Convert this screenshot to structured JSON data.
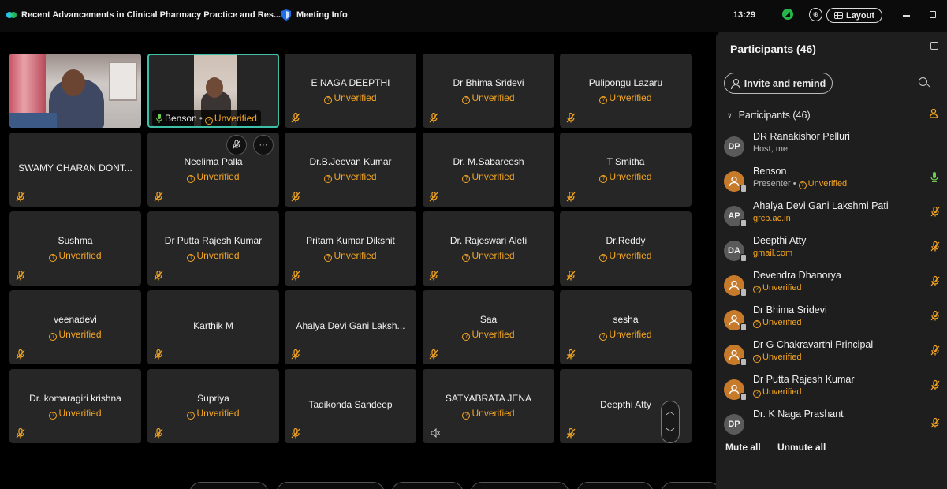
{
  "window": {
    "title": "Recent Advancements in Clinical Pharmacy Practice and Res...",
    "meeting_info": "Meeting Info",
    "time": "13:29",
    "layout_label": "Layout"
  },
  "status_unverified": "Unverified",
  "video_tiles": {
    "presenter_label": "Benson",
    "presenter_status": "Unverified"
  },
  "tiles": [
    {
      "name": "E NAGA DEEPTHI",
      "status": "Unverified"
    },
    {
      "name": "Dr Bhima Sridevi",
      "status": "Unverified"
    },
    {
      "name": "Pulipongu Lazaru",
      "status": "Unverified"
    },
    {
      "name": "SWAMY CHARAN DONT...",
      "status": ""
    },
    {
      "name": "Neelima Palla",
      "status": "Unverified"
    },
    {
      "name": "Dr.B.Jeevan Kumar",
      "status": "Unverified"
    },
    {
      "name": "Dr. M.Sabareesh",
      "status": "Unverified"
    },
    {
      "name": "T Smitha",
      "status": "Unverified"
    },
    {
      "name": "Sushma",
      "status": "Unverified"
    },
    {
      "name": "Dr Putta Rajesh Kumar",
      "status": "Unverified"
    },
    {
      "name": "Pritam Kumar Dikshit",
      "status": "Unverified"
    },
    {
      "name": "Dr. Rajeswari Aleti",
      "status": "Unverified"
    },
    {
      "name": "Dr.Reddy",
      "status": "Unverified"
    },
    {
      "name": "veenadevi",
      "status": "Unverified"
    },
    {
      "name": "Karthik M",
      "status": ""
    },
    {
      "name": "Ahalya Devi Gani Laksh...",
      "status": ""
    },
    {
      "name": "Saa",
      "status": "Unverified"
    },
    {
      "name": "sesha",
      "status": "Unverified"
    },
    {
      "name": "Dr. komaragiri krishna",
      "status": "Unverified"
    },
    {
      "name": "Supriya",
      "status": "Unverified"
    },
    {
      "name": "Tadikonda Sandeep",
      "status": ""
    },
    {
      "name": "SATYABRATA JENA",
      "status": "Unverified"
    },
    {
      "name": "Deepthi Atty",
      "status": ""
    }
  ],
  "panel": {
    "title": "Participants (46)",
    "invite_label": "Invite and remind",
    "group_label": "Participants (46)",
    "mute_all": "Mute all",
    "unmute_all": "Unmute all"
  },
  "participants": [
    {
      "initials": "DP",
      "name": "DR Ranakishor Pelluri",
      "sub": "Host, me",
      "sub_unverified": ""
    },
    {
      "initials": "",
      "name": "Benson",
      "sub": "Presenter • ",
      "sub_unverified": "Unverified"
    },
    {
      "initials": "AP",
      "name": "Ahalya Devi Gani Lakshmi Pati",
      "sub": "grcp.ac.in",
      "sub_unverified": ""
    },
    {
      "initials": "DA",
      "name": "Deepthi Atty",
      "sub": "gmail.com",
      "sub_unverified": ""
    },
    {
      "initials": "",
      "name": "Devendra Dhanorya",
      "sub": "",
      "sub_unverified": "Unverified"
    },
    {
      "initials": "",
      "name": "Dr Bhima Sridevi",
      "sub": "",
      "sub_unverified": "Unverified"
    },
    {
      "initials": "",
      "name": "Dr G Chakravarthi Principal",
      "sub": "",
      "sub_unverified": "Unverified"
    },
    {
      "initials": "",
      "name": "Dr Putta Rajesh Kumar",
      "sub": "",
      "sub_unverified": "Unverified"
    },
    {
      "initials": "DP",
      "name": "Dr. K Naga Prashant",
      "sub": "",
      "sub_unverified": ""
    }
  ],
  "colors": {
    "unverified": "#f5a623",
    "muted_mic": "#f5a623",
    "active_speaker_border": "#3fbfa8",
    "presenter_mic": "#6ecb4f"
  }
}
